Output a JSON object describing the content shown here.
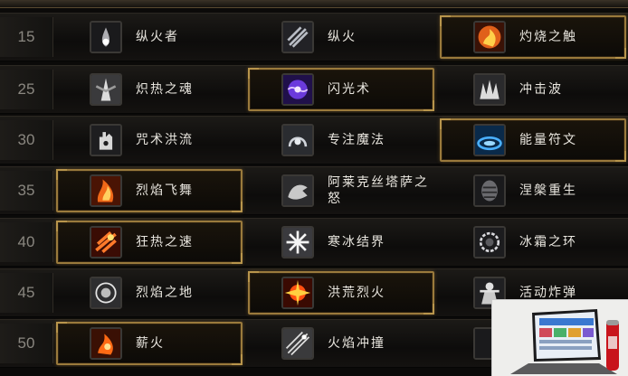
{
  "rows": [
    {
      "level": "15",
      "talents": [
        {
          "name": "纵火者",
          "icon": "fire-wisp-icon",
          "selected": false
        },
        {
          "name": "纵火",
          "icon": "claw-slash-icon",
          "selected": false
        },
        {
          "name": "灼烧之触",
          "icon": "flaming-hand-icon",
          "selected": true
        }
      ]
    },
    {
      "level": "25",
      "talents": [
        {
          "name": "炽热之魂",
          "icon": "burning-soul-icon",
          "selected": false
        },
        {
          "name": "闪光术",
          "icon": "shimmer-icon",
          "selected": true
        },
        {
          "name": "冲击波",
          "icon": "blast-wave-icon",
          "selected": false
        }
      ]
    },
    {
      "level": "30",
      "talents": [
        {
          "name": "咒术洪流",
          "icon": "rune-hand-icon",
          "selected": false
        },
        {
          "name": "专注魔法",
          "icon": "focus-magic-icon",
          "selected": false
        },
        {
          "name": "能量符文",
          "icon": "rune-of-power-icon",
          "selected": true
        }
      ]
    },
    {
      "level": "35",
      "talents": [
        {
          "name": "烈焰飞舞",
          "icon": "flame-on-icon",
          "selected": true
        },
        {
          "name": "阿莱克丝塔萨之怒",
          "icon": "dragon-icon",
          "selected": false
        },
        {
          "name": "涅槃重生",
          "icon": "phoenix-egg-icon",
          "selected": false
        }
      ]
    },
    {
      "level": "40",
      "talents": [
        {
          "name": "狂热之速",
          "icon": "frenetic-speed-icon",
          "selected": true
        },
        {
          "name": "寒冰结界",
          "icon": "ice-ward-icon",
          "selected": false
        },
        {
          "name": "冰霜之环",
          "icon": "ring-of-frost-icon",
          "selected": false
        }
      ]
    },
    {
      "level": "45",
      "talents": [
        {
          "name": "烈焰之地",
          "icon": "flame-patch-icon",
          "selected": false
        },
        {
          "name": "洪荒烈火",
          "icon": "conflagration-icon",
          "selected": true
        },
        {
          "name": "活动炸弹",
          "icon": "living-bomb-icon",
          "selected": false
        }
      ]
    },
    {
      "level": "50",
      "talents": [
        {
          "name": "薪火",
          "icon": "kindling-icon",
          "selected": true
        },
        {
          "name": "火焰冲撞",
          "icon": "cinderstorm-icon",
          "selected": false
        },
        {
          "name": "",
          "icon": "hidden-icon",
          "selected": false
        }
      ]
    }
  ],
  "colors": {
    "selected_border": "#9a7a3c",
    "text": "#e9e6df",
    "level_text": "#8a8780"
  },
  "overlay": {
    "icon": "laptop-thumbnail-icon"
  }
}
